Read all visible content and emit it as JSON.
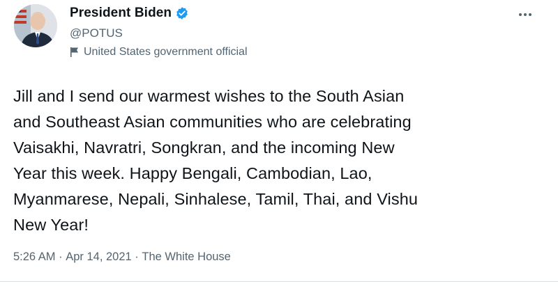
{
  "author": {
    "display_name": "President Biden",
    "handle": "@POTUS",
    "label": "United States government official",
    "verified_icon": "verified-badge-icon",
    "label_icon": "government-flag-icon",
    "accent_color": "#1d9bf0"
  },
  "menu": {
    "icon": "more-options-icon"
  },
  "tweet": {
    "text": "Jill and I send our warmest wishes to the South Asian\nand Southeast Asian communities who are celebrating\nVaisakhi, Navratri, Songkran, and the incoming New\nYear this week. Happy Bengali, Cambodian, Lao,\nMyanmarese, Nepali, Sinhalese, Tamil, Thai, and Vishu\nNew Year!",
    "time": "5:26 AM",
    "separator": " · ",
    "date": "Apr 14, 2021",
    "source": "The White House"
  }
}
